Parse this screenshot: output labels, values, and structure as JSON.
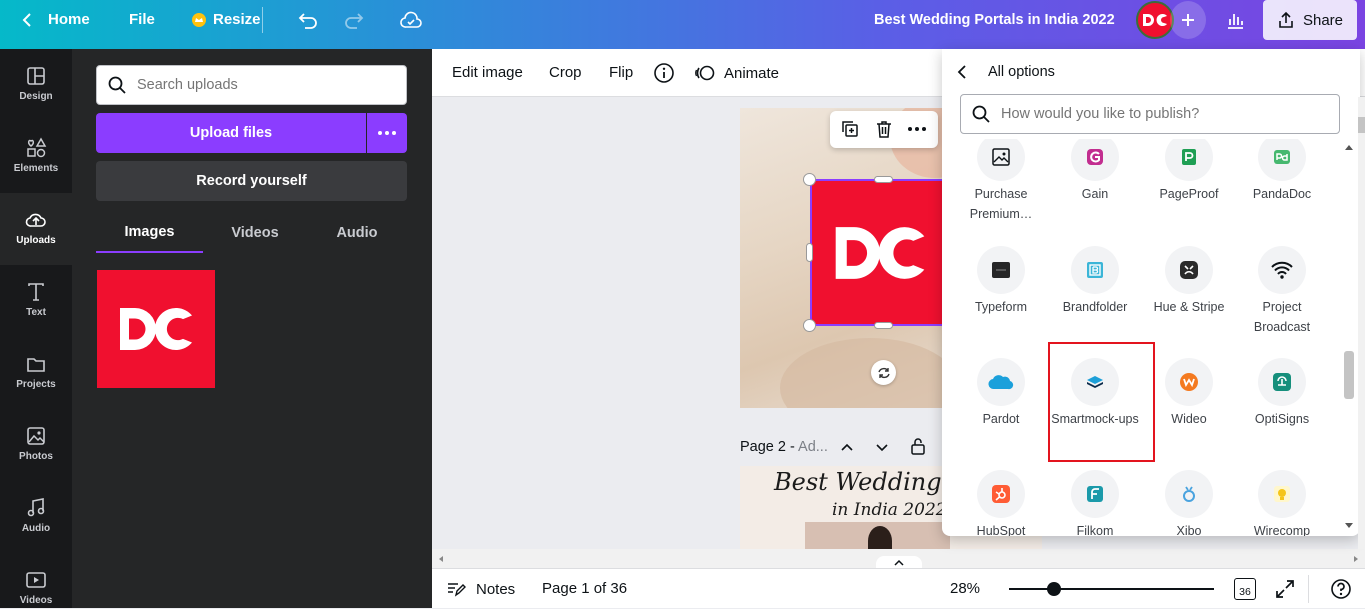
{
  "topbar": {
    "home_label": "Home",
    "file_label": "File",
    "resize_label": "Resize",
    "doc_title": "Best Wedding Portals in India 2022",
    "share_label": "Share"
  },
  "rail": {
    "items": [
      {
        "label": "Design"
      },
      {
        "label": "Elements"
      },
      {
        "label": "Uploads"
      },
      {
        "label": "Text"
      },
      {
        "label": "Projects"
      },
      {
        "label": "Photos"
      },
      {
        "label": "Audio"
      },
      {
        "label": "Videos"
      }
    ]
  },
  "uploads": {
    "search_placeholder": "Search uploads",
    "upload_label": "Upload files",
    "record_label": "Record yourself",
    "tabs": [
      "Images",
      "Videos",
      "Audio"
    ]
  },
  "toolbar": {
    "edit_image": "Edit image",
    "crop": "Crop",
    "flip": "Flip",
    "animate": "Animate"
  },
  "canvas": {
    "page2_label": "Page 2 - ",
    "page2_title": "Ad...",
    "page2_heading1": "Best Wedding Por",
    "page2_heading2": "in India 2022"
  },
  "bottom": {
    "notes_label": "Notes",
    "page_indicator": "Page 1 of 36",
    "zoom": "28%",
    "zoom_fraction": 0.22,
    "page_count": "36"
  },
  "publish_menu": {
    "back_label": "All options",
    "search_placeholder": "How would you like to publish?",
    "options": [
      {
        "label": "Purchase Premium…",
        "icon": "image-icon"
      },
      {
        "label": "Gain",
        "icon": "gain-icon"
      },
      {
        "label": "PageProof",
        "icon": "pageproof-icon"
      },
      {
        "label": "PandaDoc",
        "icon": "pandadoc-icon"
      },
      {
        "label": "Typeform",
        "icon": "typeform-icon"
      },
      {
        "label": "Brandfolder",
        "icon": "brandfolder-icon"
      },
      {
        "label": "Hue & Stripe",
        "icon": "hue-stripe-icon"
      },
      {
        "label": "Project Broadcast",
        "icon": "wifi-icon"
      },
      {
        "label": "Pardot",
        "icon": "salesforce-icon"
      },
      {
        "label": "Smartmock-ups",
        "icon": "smartmockups-icon"
      },
      {
        "label": "Wideo",
        "icon": "wideo-icon"
      },
      {
        "label": "OptiSigns",
        "icon": "optisigns-icon"
      },
      {
        "label": "HubSpot",
        "icon": "hubspot-icon"
      },
      {
        "label": "Filkom",
        "icon": "filkom-icon"
      },
      {
        "label": "Xibo",
        "icon": "xibo-icon"
      },
      {
        "label": "Wirecomp",
        "icon": "wirecomp-icon"
      }
    ]
  },
  "colors": {
    "brand_red": "#f0102f",
    "accent_purple": "#8b3dff",
    "highlight": "#e3141e"
  }
}
